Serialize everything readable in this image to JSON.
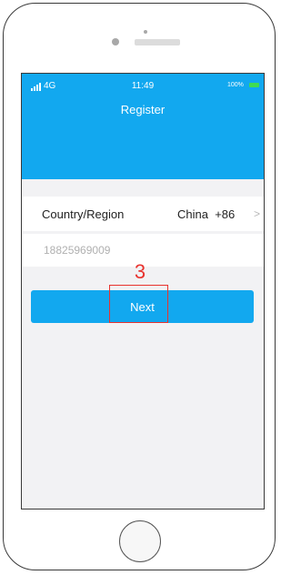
{
  "status_bar": {
    "network": "4G",
    "time": "11:49",
    "battery": "100%"
  },
  "header": {
    "title": "Register"
  },
  "country_row": {
    "label": "Country/Region",
    "value": "China  +86",
    "chevron": ">"
  },
  "phone_field": {
    "value": "18825969009"
  },
  "next_button": {
    "label": "Next"
  },
  "annotation": {
    "step": "3",
    "color": "#e8332e"
  },
  "colors": {
    "accent": "#12a8ef",
    "battery": "#3fdc52"
  },
  "icons": [
    "signal-icon",
    "battery-icon",
    "chevron-right-icon",
    "home-button-icon"
  ]
}
